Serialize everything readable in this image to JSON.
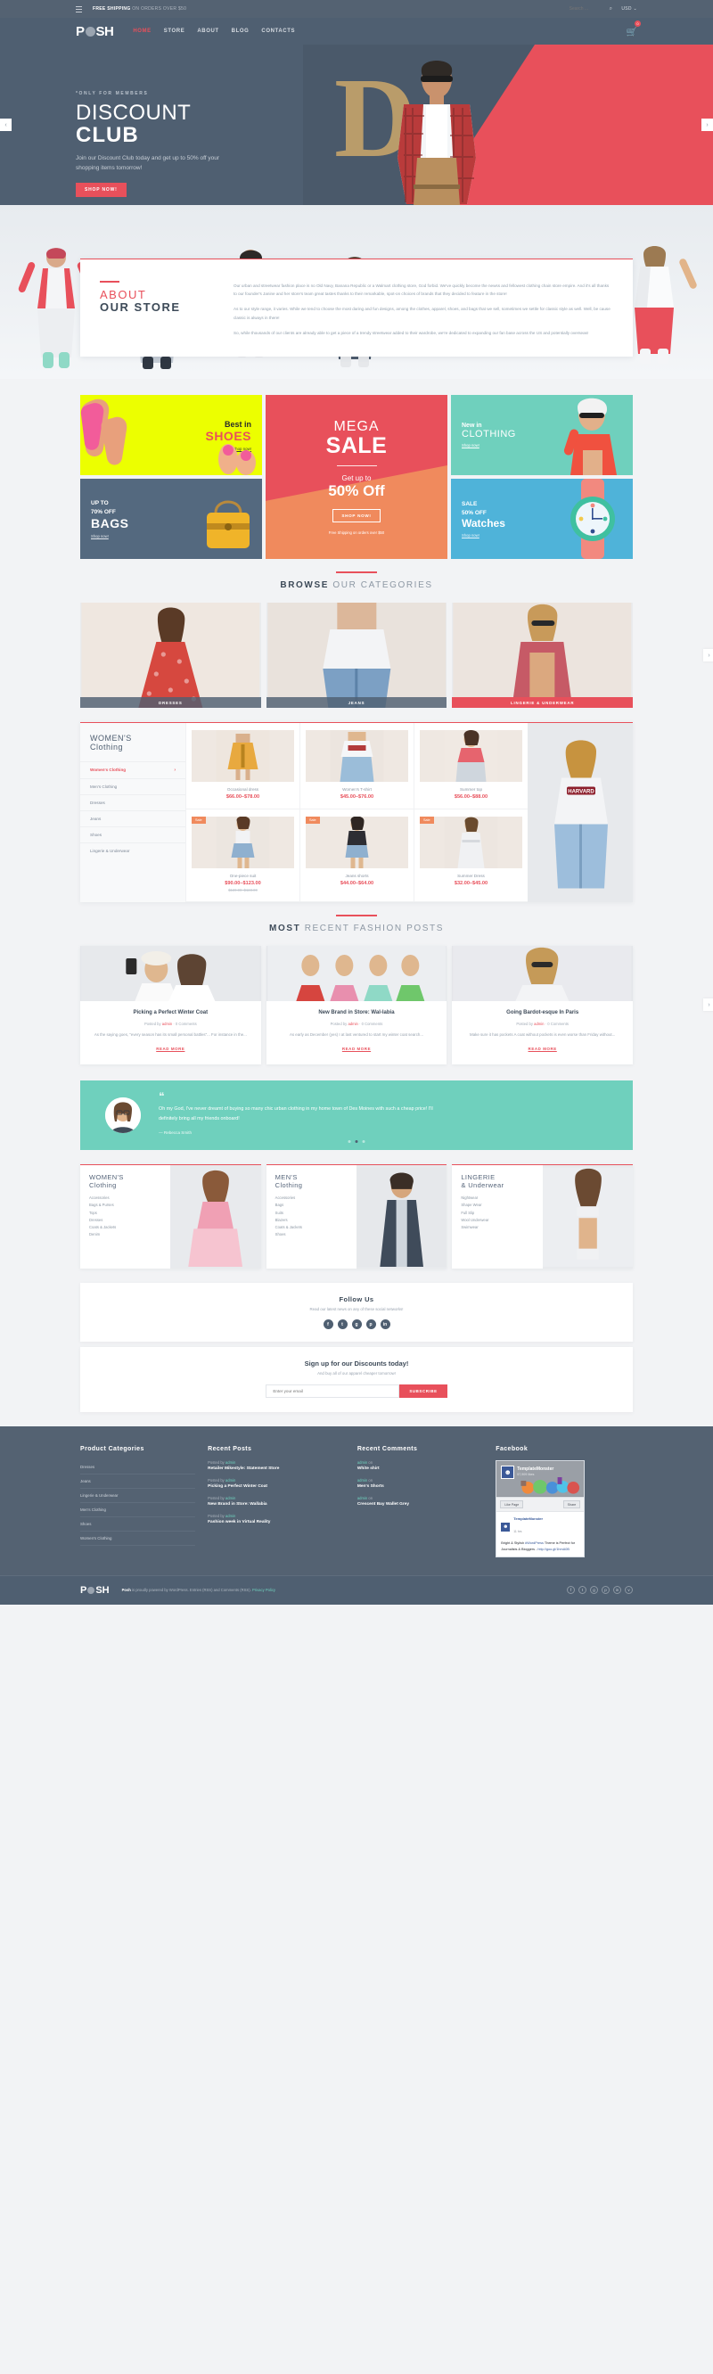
{
  "topbar": {
    "menu_icon": "hamburger-icon",
    "shipping_bold": "FREE SHIPPING",
    "shipping_rest": " ON ORDERS OVER $50",
    "search_placeholder": "Search ...",
    "search_icon": "search-icon",
    "currency": "USD",
    "currency_caret": "⌄"
  },
  "header": {
    "logo_left": "P",
    "logo_right": "SH",
    "nav": [
      {
        "label": "HOME",
        "active": true
      },
      {
        "label": "STORE",
        "active": false
      },
      {
        "label": "ABOUT",
        "active": false
      },
      {
        "label": "BLOG",
        "active": false
      },
      {
        "label": "CONTACTS",
        "active": false
      }
    ],
    "cart_icon": "shopping-cart-icon",
    "cart_count": "0"
  },
  "hero": {
    "kicker": "*ONLY FOR MEMBERS",
    "title_top": "DISCOUNT",
    "title_bottom": "CLUB",
    "subtitle": "Join our Discount Club today and get up to 50% off your shopping items tomorrow!",
    "button": "SHOP NOW!",
    "decor_letter": "D",
    "prev_arrow": "‹",
    "next_arrow": "›"
  },
  "about": {
    "eyebrow_line": "",
    "title_1": "ABOUT",
    "title_2": "OUR STORE",
    "p1": "Our urban and streetwear fashion place is no Old Navy, Banana Republic or a Walmart clothing store, God forbid. We've quickly become the newss and fellowest clothing chain store empire. And it's all thanks to our founder's Janine and her store's team great tastes thanks to their remarkable, spot-on choices of brands that they decided to feature in the store!",
    "p2": "As to our style range, it varies. While we tend to choose the most daring and fun designs, among the clothes, apparel, shoes, and bags that we sell, sometimes we settle for classic style as well. Well, be cause classic is always in there!",
    "p3": "So, while thousands of our clients are already able to get a piece of a trendy streetwear added to their wardrobe, we're dedicated to expanding our fan base across the US and potentially overseas!"
  },
  "promos": {
    "shoes": {
      "line1": "Best in",
      "line2": "SHOES",
      "cta": "Shop now!"
    },
    "mega": {
      "line1": "MEGA",
      "line2": "SALE",
      "line3": "Get up to",
      "line4": "50% Off",
      "button": "SHOP NOW!",
      "note": "Free Shipping on orders over $50"
    },
    "clothing": {
      "line1": "New in",
      "line2": "CLOTHING",
      "cta": "Shop now!"
    },
    "bags": {
      "line1": "UP TO\n70% OFF",
      "line2": "BAGS",
      "cta": "Shop now!"
    },
    "watches": {
      "line1": "SALE\n50% OFF",
      "line2": "Watches",
      "cta": "Shop now!"
    }
  },
  "categories_section": {
    "title_bold": "BROWSE",
    "title_rest": " OUR CATEGORIES",
    "items": [
      {
        "label": "DRESSES",
        "accent": false
      },
      {
        "label": "JEANS",
        "accent": false
      },
      {
        "label": "LINGERIE & UNDERWEAR",
        "accent": true
      }
    ],
    "next_arrow": "›"
  },
  "shop": {
    "heading_1": "WOMEN'S",
    "heading_2": "Clothing",
    "menu": [
      {
        "label": "Women's Clothing",
        "active": true,
        "chevron": "›"
      },
      {
        "label": "Men's Clothing",
        "active": false,
        "chevron": ""
      },
      {
        "label": "Dresses",
        "active": false,
        "chevron": ""
      },
      {
        "label": "Jeans",
        "active": false,
        "chevron": ""
      },
      {
        "label": "Shoes",
        "active": false,
        "chevron": ""
      },
      {
        "label": "Lingerie & Underwear",
        "active": false,
        "chevron": ""
      }
    ],
    "products": [
      {
        "name": "Occasional dress",
        "price": "$66.00–$78.00",
        "old": "",
        "sale": ""
      },
      {
        "name": "Women's T-shirt",
        "price": "$45.00–$76.00",
        "old": "",
        "sale": ""
      },
      {
        "name": "Summer top",
        "price": "$56.00–$88.00",
        "old": "",
        "sale": ""
      },
      {
        "name": "One-piece suit",
        "price": "$90.00–$123.00",
        "old": "$120.00–$123.00",
        "sale": "Sale"
      },
      {
        "name": "Jeans shorts",
        "price": "$44.00–$64.00",
        "old": "",
        "sale": "Sale"
      },
      {
        "name": "Summer Dress",
        "price": "$32.00–$45.00",
        "old": "",
        "sale": "Sale"
      }
    ]
  },
  "blog_section": {
    "title_bold": "MOST",
    "title_rest": " RECENT FASHION POSTS",
    "next_arrow": "›",
    "posts": [
      {
        "title": "Picking a Perfect Winter Coat",
        "meta_prefix": "Posted by ",
        "author": "admin",
        "meta_sep": " · ",
        "comments": "0 Comments",
        "excerpt": "As the saying goes, \"every season has its small personal battles\"... For instance in the...",
        "more": "READ MORE"
      },
      {
        "title": "New Brand in Store: Wal-labia",
        "meta_prefix": "Posted by ",
        "author": "admin",
        "meta_sep": " · ",
        "comments": "0 Comments",
        "excerpt": "As early as December (yes) I at last ventured to start my winter coat search...",
        "more": "READ MORE"
      },
      {
        "title": "Going Bardot-esque In Paris",
        "meta_prefix": "Posted by ",
        "author": "admin",
        "meta_sep": " · ",
        "comments": "0 Comments",
        "excerpt": "Make sure it has pockets A coat without pockets is even worse than Friday without...",
        "more": "READ MORE"
      }
    ]
  },
  "testimonial": {
    "quote_mark": "❝",
    "text": "Oh my God, I've never dreamt of buying so many chic urban clothing in my home town of Des Moines with such a cheap price! I'll definitely bring all my friends onboard!",
    "author": "— Rebecca Smith",
    "dots": 3,
    "active_dot": 1
  },
  "triad": [
    {
      "title_1": "WOMEN'S",
      "title_2": "Clothing",
      "items": [
        "Accessories",
        "Bags & Purses",
        "Tops",
        "Dresses",
        "Coats & Jackets",
        "Denim"
      ]
    },
    {
      "title_1": "MEN'S",
      "title_2": "Clothing",
      "items": [
        "Accessories",
        "Bags",
        "Suits",
        "Blazers",
        "Coats & Jackets",
        "Shoes"
      ]
    },
    {
      "title_1": "LINGERIE",
      "title_2": "& Underwear",
      "items": [
        "Nightwear",
        "Shape Wear",
        "Full Slip",
        "Wool Underwear",
        "Swimwear"
      ]
    }
  ],
  "follow": {
    "title": "Follow Us",
    "subtitle": "Read our latest news on any of these social networks!",
    "socials": [
      "f",
      "t",
      "g",
      "p",
      "in"
    ]
  },
  "subscribe": {
    "title": "Sign up for our Discounts today!",
    "subtitle": "And buy all of our apparel cheaper tomorrow!",
    "placeholder": "Enter your email",
    "button": "SUBSCRIBE"
  },
  "footer": {
    "product_categories": {
      "title": "Product Categories",
      "items": [
        "Dresses",
        "Jeans",
        "Lingerie & Underwear",
        "Men's Clothing",
        "Shoes",
        "Women's Clothing"
      ]
    },
    "recent_posts": {
      "title": "Recent Posts",
      "items": [
        {
          "by": "Posted by ",
          "author": "admin",
          "title": "Retailer Mikestyle: Statement Store"
        },
        {
          "by": "Posted by ",
          "author": "admin",
          "title": "Picking a Perfect Winter Coat"
        },
        {
          "by": "Posted by ",
          "author": "admin",
          "title": "New Brand in Store: Wallabia"
        },
        {
          "by": "Posted by ",
          "author": "admin",
          "title": "Fashion week in Virtual Reality"
        }
      ]
    },
    "recent_comments": {
      "title": "Recent Comments",
      "items": [
        {
          "author": "admin",
          "on": " on",
          "title": "White shirt"
        },
        {
          "author": "admin",
          "on": " on",
          "title": "Men's Shorts"
        },
        {
          "author": "admin",
          "on": " on",
          "title": "Crescent Bay Wallet Grey"
        }
      ]
    },
    "facebook": {
      "title": "Facebook",
      "page_name": "TemplateMonster",
      "likes": "57,909 likes",
      "like_button": "Like Page",
      "share_button": "Share",
      "post_name": "TemplateMonster",
      "post_time": "11 hrs",
      "post_text_1": "Bright & Stylish ",
      "post_tag": "#WordPress",
      "post_text_2": " Theme is Perfect for Journalists & Bloggers - ",
      "post_link": "http://goo.gl/1hmA0B"
    }
  },
  "footbar": {
    "logo_left": "P",
    "logo_right": "SH",
    "copy_bold": "Posh",
    "copy_rest": " is proudly powered by WordPress. Entries (RSS) and Comments (RSS).",
    "privacy": "Privacy Policy",
    "socials": [
      "f",
      "t",
      "g",
      "p",
      "in",
      "v"
    ]
  }
}
